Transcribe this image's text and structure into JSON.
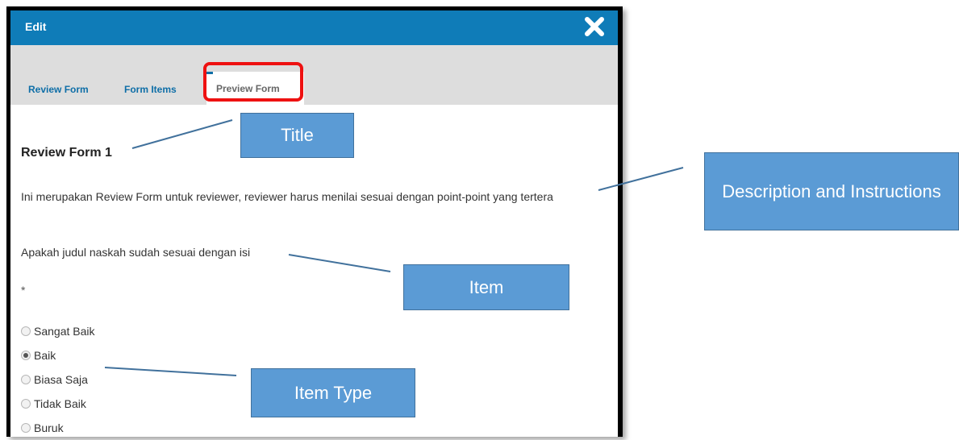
{
  "modal": {
    "title": "Edit",
    "close_icon": "close-x-icon"
  },
  "tabs": [
    {
      "label": "Review Form"
    },
    {
      "label": "Form Items"
    },
    {
      "label": "Preview Form",
      "active": true
    }
  ],
  "preview": {
    "form_title": "Review Form 1",
    "description": "Ini merupakan Review Form untuk reviewer, reviewer harus menilai sesuai dengan point-point yang tertera",
    "item_question": "Apakah judul naskah sudah sesuai dengan isi",
    "required_mark": "*",
    "options": [
      "Sangat Baik",
      "Baik",
      "Biasa Saja",
      "Tidak Baik",
      "Buruk"
    ],
    "selected_option": "Baik"
  },
  "callouts": {
    "title": "Title",
    "description": "Description and Instructions",
    "item": "Item",
    "item_type": "Item Type"
  },
  "colors": {
    "header": "#0f7cb8",
    "tab_text": "#0e6ea7",
    "highlight": "#ee1111",
    "callout_fill": "#5b9bd5"
  }
}
